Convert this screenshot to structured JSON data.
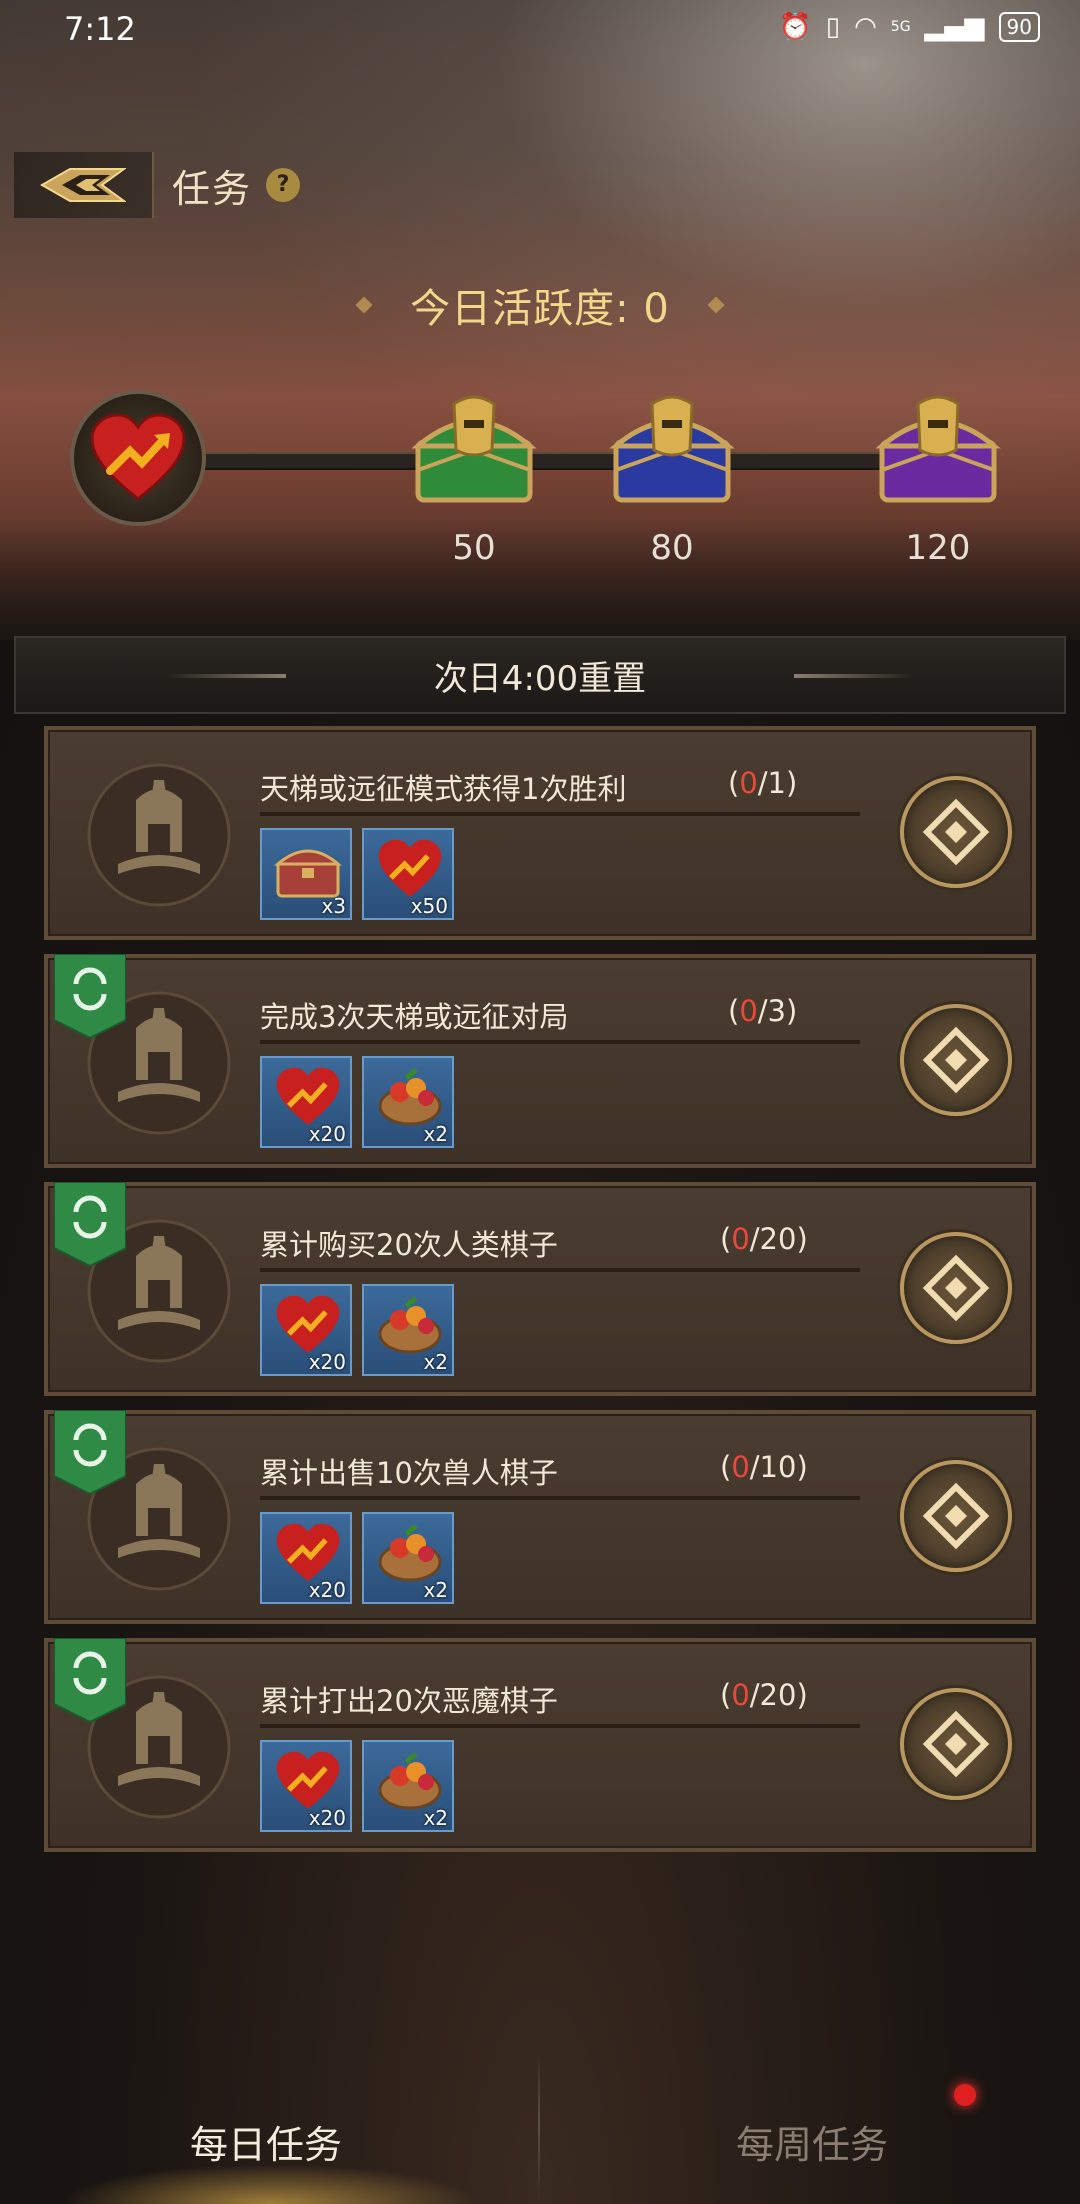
{
  "status_bar": {
    "time": "7:12",
    "battery": "90",
    "network": "5G"
  },
  "header": {
    "title": "任务"
  },
  "activity": {
    "label": "今日活跃度: 0"
  },
  "milestones": [
    {
      "value": "50",
      "chest_color": "#2f8a3a"
    },
    {
      "value": "80",
      "chest_color": "#2a3aa0"
    },
    {
      "value": "120",
      "chest_color": "#6a2aa0"
    }
  ],
  "reset_banner": {
    "text": "次日4:00重置"
  },
  "tasks": [
    {
      "title": "天梯或远征模式获得1次胜利",
      "progress_open": "(",
      "current": "0",
      "total": "/1)",
      "repeatable": false,
      "rewards": [
        {
          "icon": "treasure-chest-icon",
          "qty": "x3"
        },
        {
          "icon": "heart-activity-icon",
          "qty": "x50"
        }
      ]
    },
    {
      "title": "完成3次天梯或远征对局",
      "progress_open": "(",
      "current": "0",
      "total": "/3)",
      "repeatable": true,
      "rewards": [
        {
          "icon": "heart-activity-icon",
          "qty": "x20"
        },
        {
          "icon": "fruit-basket-icon",
          "qty": "x2"
        }
      ]
    },
    {
      "title": "累计购买20次人类棋子",
      "progress_open": "(",
      "current": "0",
      "total": "/20)",
      "repeatable": true,
      "rewards": [
        {
          "icon": "heart-activity-icon",
          "qty": "x20"
        },
        {
          "icon": "fruit-basket-icon",
          "qty": "x2"
        }
      ]
    },
    {
      "title": "累计出售10次兽人棋子",
      "progress_open": "(",
      "current": "0",
      "total": "/10)",
      "repeatable": true,
      "rewards": [
        {
          "icon": "heart-activity-icon",
          "qty": "x20"
        },
        {
          "icon": "fruit-basket-icon",
          "qty": "x2"
        }
      ]
    },
    {
      "title": "累计打出20次恶魔棋子",
      "progress_open": "(",
      "current": "0",
      "total": "/20)",
      "repeatable": true,
      "rewards": [
        {
          "icon": "heart-activity-icon",
          "qty": "x20"
        },
        {
          "icon": "fruit-basket-icon",
          "qty": "x2"
        }
      ]
    }
  ],
  "tabs": {
    "daily": "每日任务",
    "weekly": "每周任务"
  },
  "colors": {
    "accent_gold": "#f4d88a",
    "progress_current": "#e84a3a",
    "reward_bg": "#2a4e78"
  }
}
